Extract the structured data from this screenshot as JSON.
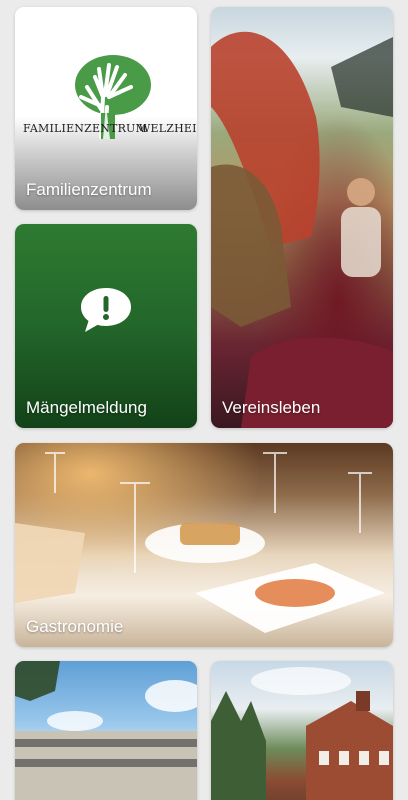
{
  "tiles": {
    "familienzentrum": {
      "label": "Familienzentrum",
      "logo_left": "FAMILIENZENTRUM",
      "logo_right": "WELZHEIM"
    },
    "maengelmeldung": {
      "label": "Mängelmeldung"
    },
    "vereinsleben": {
      "label": "Vereinsleben"
    },
    "gastronomie": {
      "label": "Gastronomie"
    }
  },
  "colors": {
    "logo_green": "#4a9b48",
    "maengel_green": "#23662a"
  },
  "icons": {
    "familienzentrum": "hands-tree-icon",
    "maengelmeldung": "exclamation-bubble-icon"
  }
}
